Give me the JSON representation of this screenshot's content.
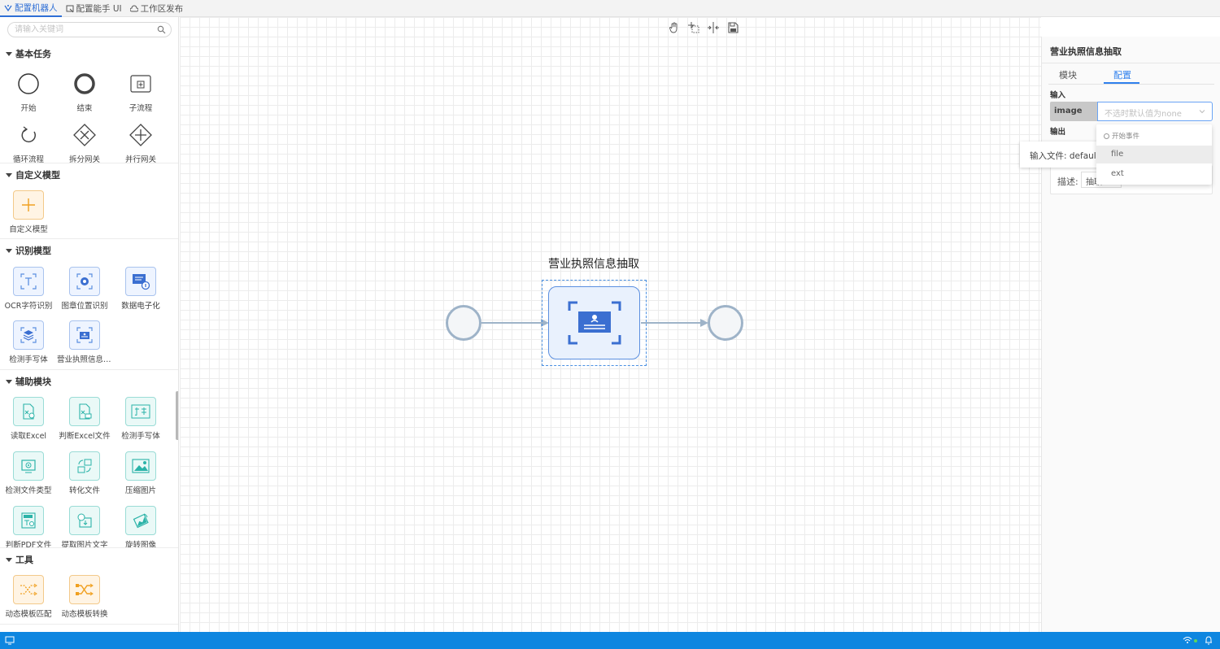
{
  "top_tabs": [
    {
      "label": "配置机器人",
      "icon": "robot-config-icon",
      "active": true
    },
    {
      "label": "配置能手 UI",
      "icon": "ui-config-icon",
      "active": false
    },
    {
      "label": "工作区发布",
      "icon": "cloud-publish-icon",
      "active": false
    }
  ],
  "sidebar": {
    "search_placeholder": "请输入关键词",
    "sections": {
      "basic": {
        "title": "基本任务",
        "items": [
          "开始",
          "结束",
          "子流程",
          "循环流程",
          "拆分网关",
          "并行网关"
        ]
      },
      "custom": {
        "title": "自定义模型",
        "items": [
          "自定义模型"
        ]
      },
      "recognition": {
        "title": "识别模型",
        "items": [
          "OCR字符识别",
          "图章位置识别",
          "数据电子化",
          "检测手写体",
          "营业执照信息抽取"
        ]
      },
      "auxiliary": {
        "title": "辅助模块",
        "items": [
          "读取Excel",
          "判断Excel文件",
          "检测手写体",
          "检测文件类型",
          "转化文件",
          "压缩图片",
          "判断PDF文件",
          "提取图片文字",
          "旋转图像"
        ]
      },
      "tools": {
        "title": "工具",
        "items": [
          "动态模板匹配",
          "动态模板转换"
        ]
      }
    }
  },
  "canvas": {
    "toolbar": [
      "hand-tool-icon",
      "select-area-icon",
      "align-icon",
      "save-icon"
    ],
    "task_node_title": "营业执照信息抽取"
  },
  "right_panel": {
    "title": "营业执照信息抽取",
    "tabs": [
      "模块",
      "配置"
    ],
    "active_tab": "配置",
    "input_label": "输入",
    "input_key": "image",
    "input_placeholder": "不选时默认值为none",
    "output_label": "输出",
    "desc_label": "描述:",
    "desc_value": "抽取"
  },
  "tooltip": {
    "text": "输入文件: default"
  },
  "dropdown": {
    "group": "开始事件",
    "options": [
      "file",
      "ext"
    ],
    "highlighted": "file"
  },
  "colors": {
    "accent": "#2f80ed",
    "status_bar": "#0e86e0",
    "node_border": "#5b8fe0"
  }
}
